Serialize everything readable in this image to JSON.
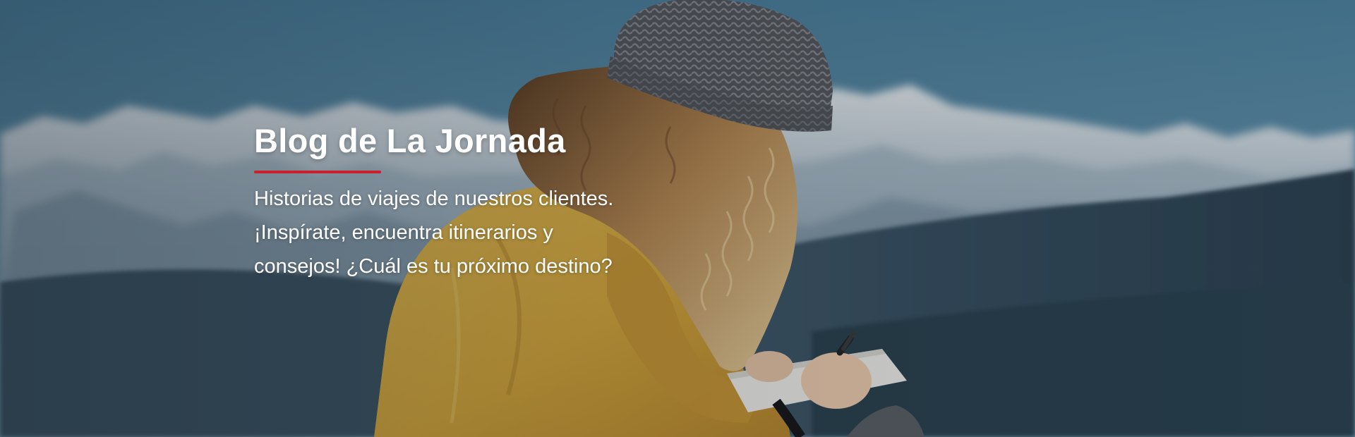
{
  "hero": {
    "title": "Blog de La Jornada",
    "description": "Historias de viajes de nuestros clientes. ¡Inspírate, encuentra itinerarios y consejos! ¿Cuál es tu próximo destino?",
    "background_image": "woman-writing-in-notebook-mountains-photo"
  },
  "colors": {
    "accent": "#c8202c",
    "text": "#ffffff",
    "sky": "#4b7d99",
    "mountain": "#2e4556",
    "jacket": "#d9ac3c",
    "beanie": "#5a5a5d"
  }
}
